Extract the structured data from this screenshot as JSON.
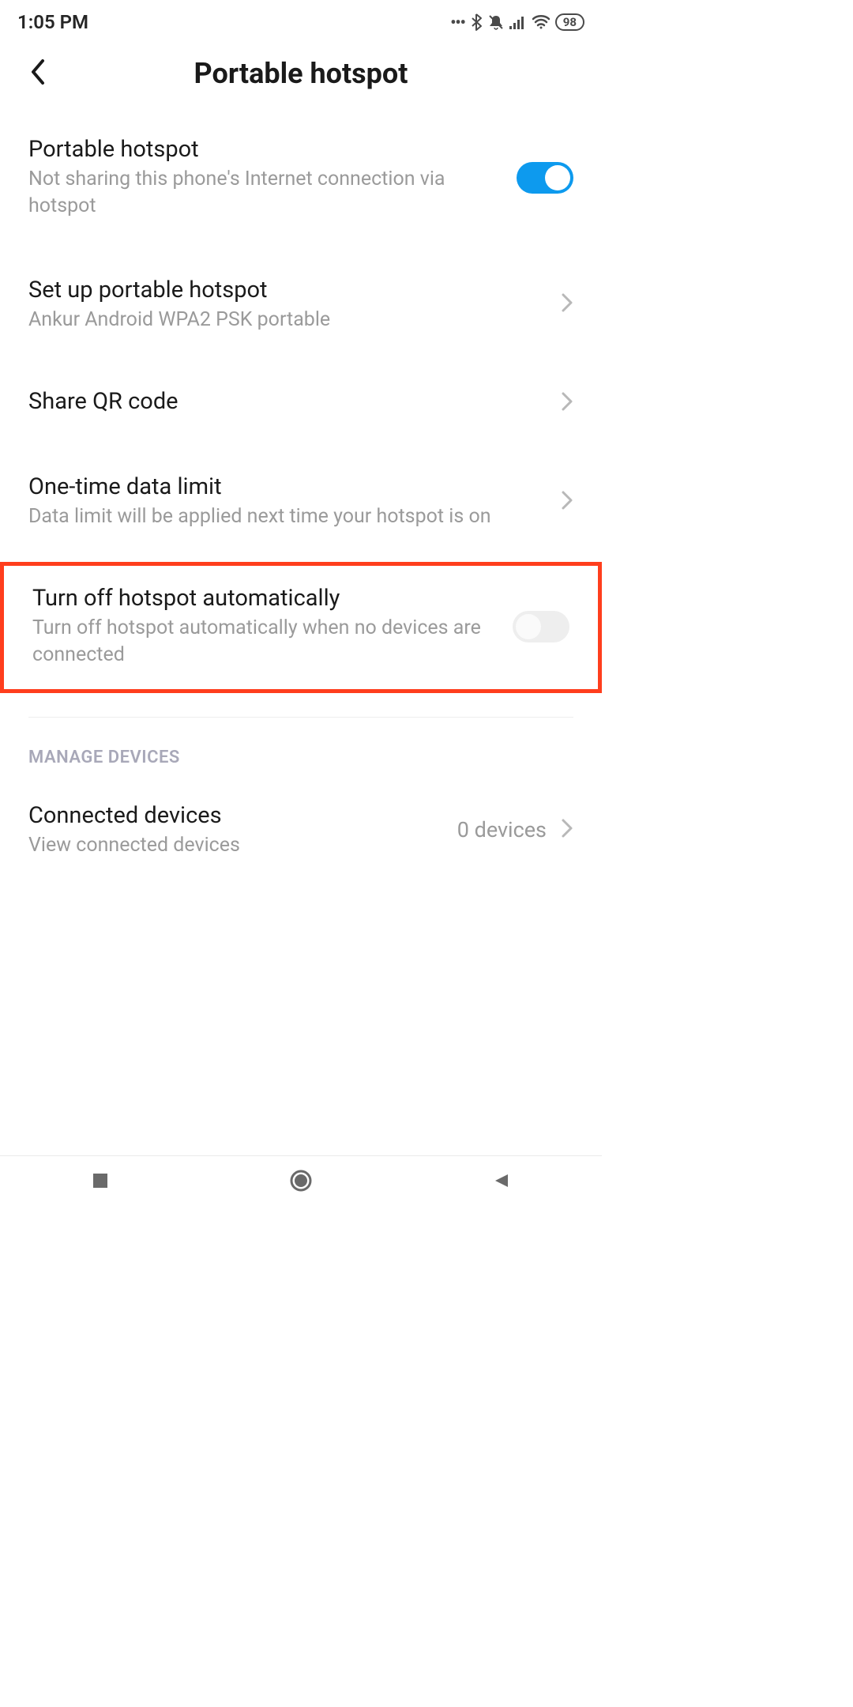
{
  "statusBar": {
    "time": "1:05 PM",
    "battery": "98"
  },
  "header": {
    "title": "Portable hotspot"
  },
  "settings": {
    "hotspot": {
      "title": "Portable hotspot",
      "subtitle": "Not sharing this phone's Internet connection via hotspot",
      "toggled": true
    },
    "setup": {
      "title": "Set up portable hotspot",
      "subtitle": "Ankur Android WPA2 PSK portable"
    },
    "qr": {
      "title": "Share QR code"
    },
    "dataLimit": {
      "title": "One-time data limit",
      "subtitle": "Data limit will be applied next time your hotspot is on"
    },
    "autoOff": {
      "title": "Turn off hotspot automatically",
      "subtitle": "Turn off hotspot automatically when no devices are connected",
      "toggled": false
    }
  },
  "sections": {
    "manageDevices": "MANAGE DEVICES"
  },
  "connected": {
    "title": "Connected devices",
    "subtitle": "View connected devices",
    "value": "0 devices"
  }
}
